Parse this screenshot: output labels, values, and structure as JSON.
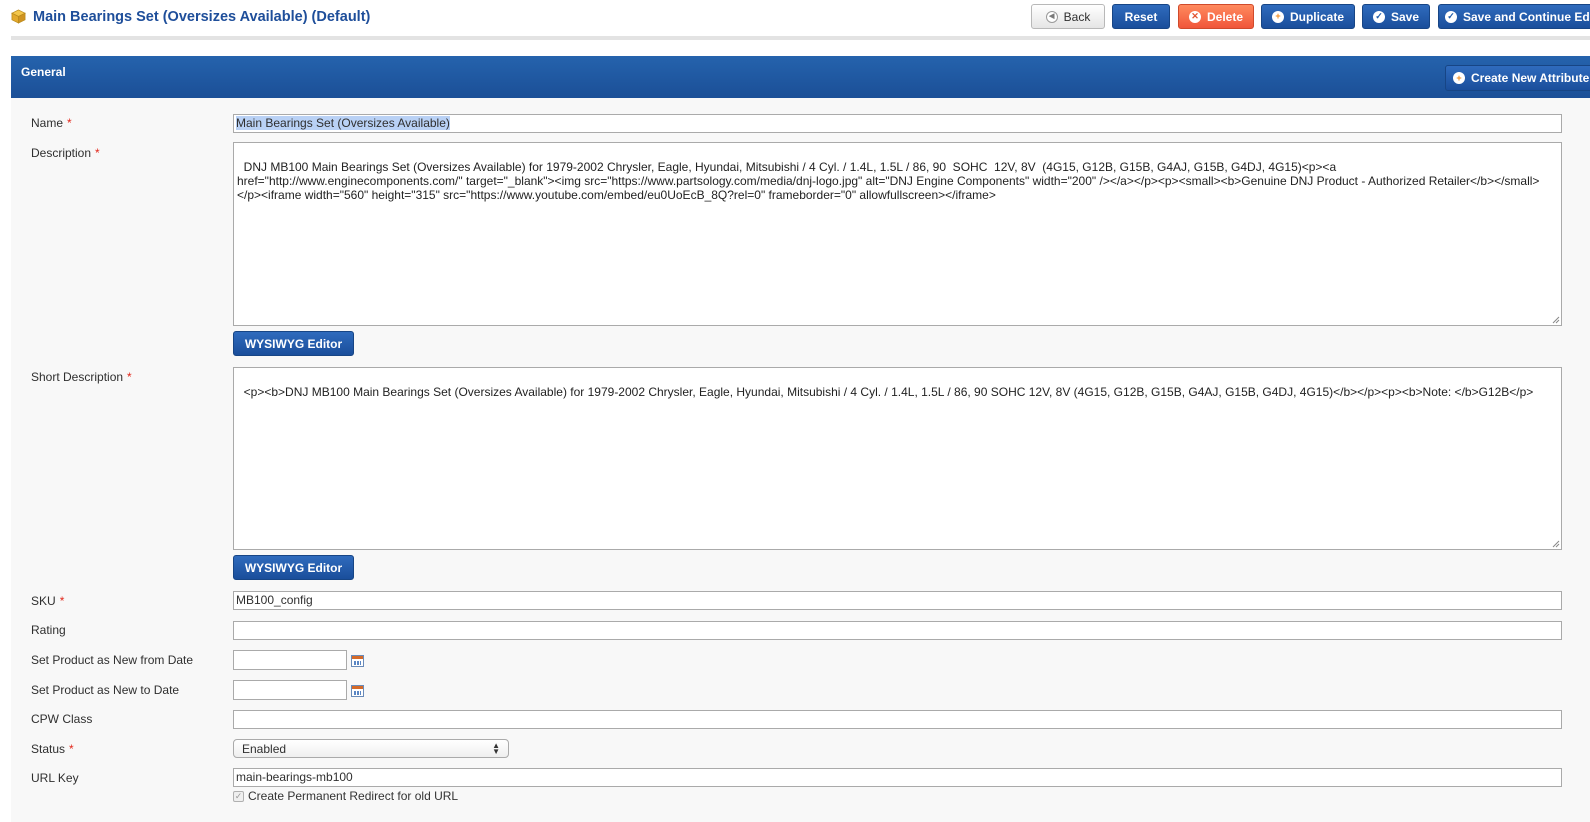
{
  "header": {
    "title": "Main Bearings Set (Oversizes Available) (Default)",
    "buttons": {
      "back": "Back",
      "reset": "Reset",
      "delete": "Delete",
      "duplicate": "Duplicate",
      "save": "Save",
      "save_continue": "Save and Continue Edit"
    }
  },
  "panel": {
    "title": "General",
    "create_attribute": "Create New Attribute"
  },
  "fields": {
    "name": {
      "label": "Name",
      "required": "*",
      "value": "Main Bearings Set (Oversizes Available)"
    },
    "description": {
      "label": "Description",
      "required": "*",
      "value": "DNJ MB100 Main Bearings Set (Oversizes Available) for 1979-2002 Chrysler, Eagle, Hyundai, Mitsubishi / 4 Cyl. / 1.4L, 1.5L / 86, 90  SOHC  12V, 8V  (4G15, G12B, G15B, G4AJ, G15B, G4DJ, 4G15)<p><a href=\"http://www.enginecomponents.com/\" target=\"_blank\"><img src=\"https://www.partsology.com/media/dnj-logo.jpg\" alt=\"DNJ Engine Components\" width=\"200\" /></a></p><p><small><b>Genuine DNJ Product - Authorized Retailer</b></small></p><iframe width=\"560\" height=\"315\" src=\"https://www.youtube.com/embed/eu0UoEcB_8Q?rel=0\" frameborder=\"0\" allowfullscreen></iframe>",
      "editor_button": "WYSIWYG Editor"
    },
    "short_description": {
      "label": "Short Description",
      "required": "*",
      "value": "<p><b>DNJ MB100 Main Bearings Set (Oversizes Available) for 1979-2002 Chrysler, Eagle, Hyundai, Mitsubishi / 4 Cyl. / 1.4L, 1.5L / 86, 90 SOHC 12V, 8V (4G15, G12B, G15B, G4AJ, G15B, G4DJ, 4G15)</b></p><p><b>Note: </b>G12B</p>",
      "editor_button": "WYSIWYG Editor"
    },
    "sku": {
      "label": "SKU",
      "required": "*",
      "value": "MB100_config"
    },
    "rating": {
      "label": "Rating",
      "value": ""
    },
    "new_from": {
      "label": "Set Product as New from Date",
      "value": ""
    },
    "new_to": {
      "label": "Set Product as New to Date",
      "value": ""
    },
    "cpw_class": {
      "label": "CPW Class",
      "value": ""
    },
    "status": {
      "label": "Status",
      "required": "*",
      "value": "Enabled"
    },
    "url_key": {
      "label": "URL Key",
      "value": "main-bearings-mb100",
      "redirect_label": "Create Permanent Redirect for old URL"
    }
  }
}
